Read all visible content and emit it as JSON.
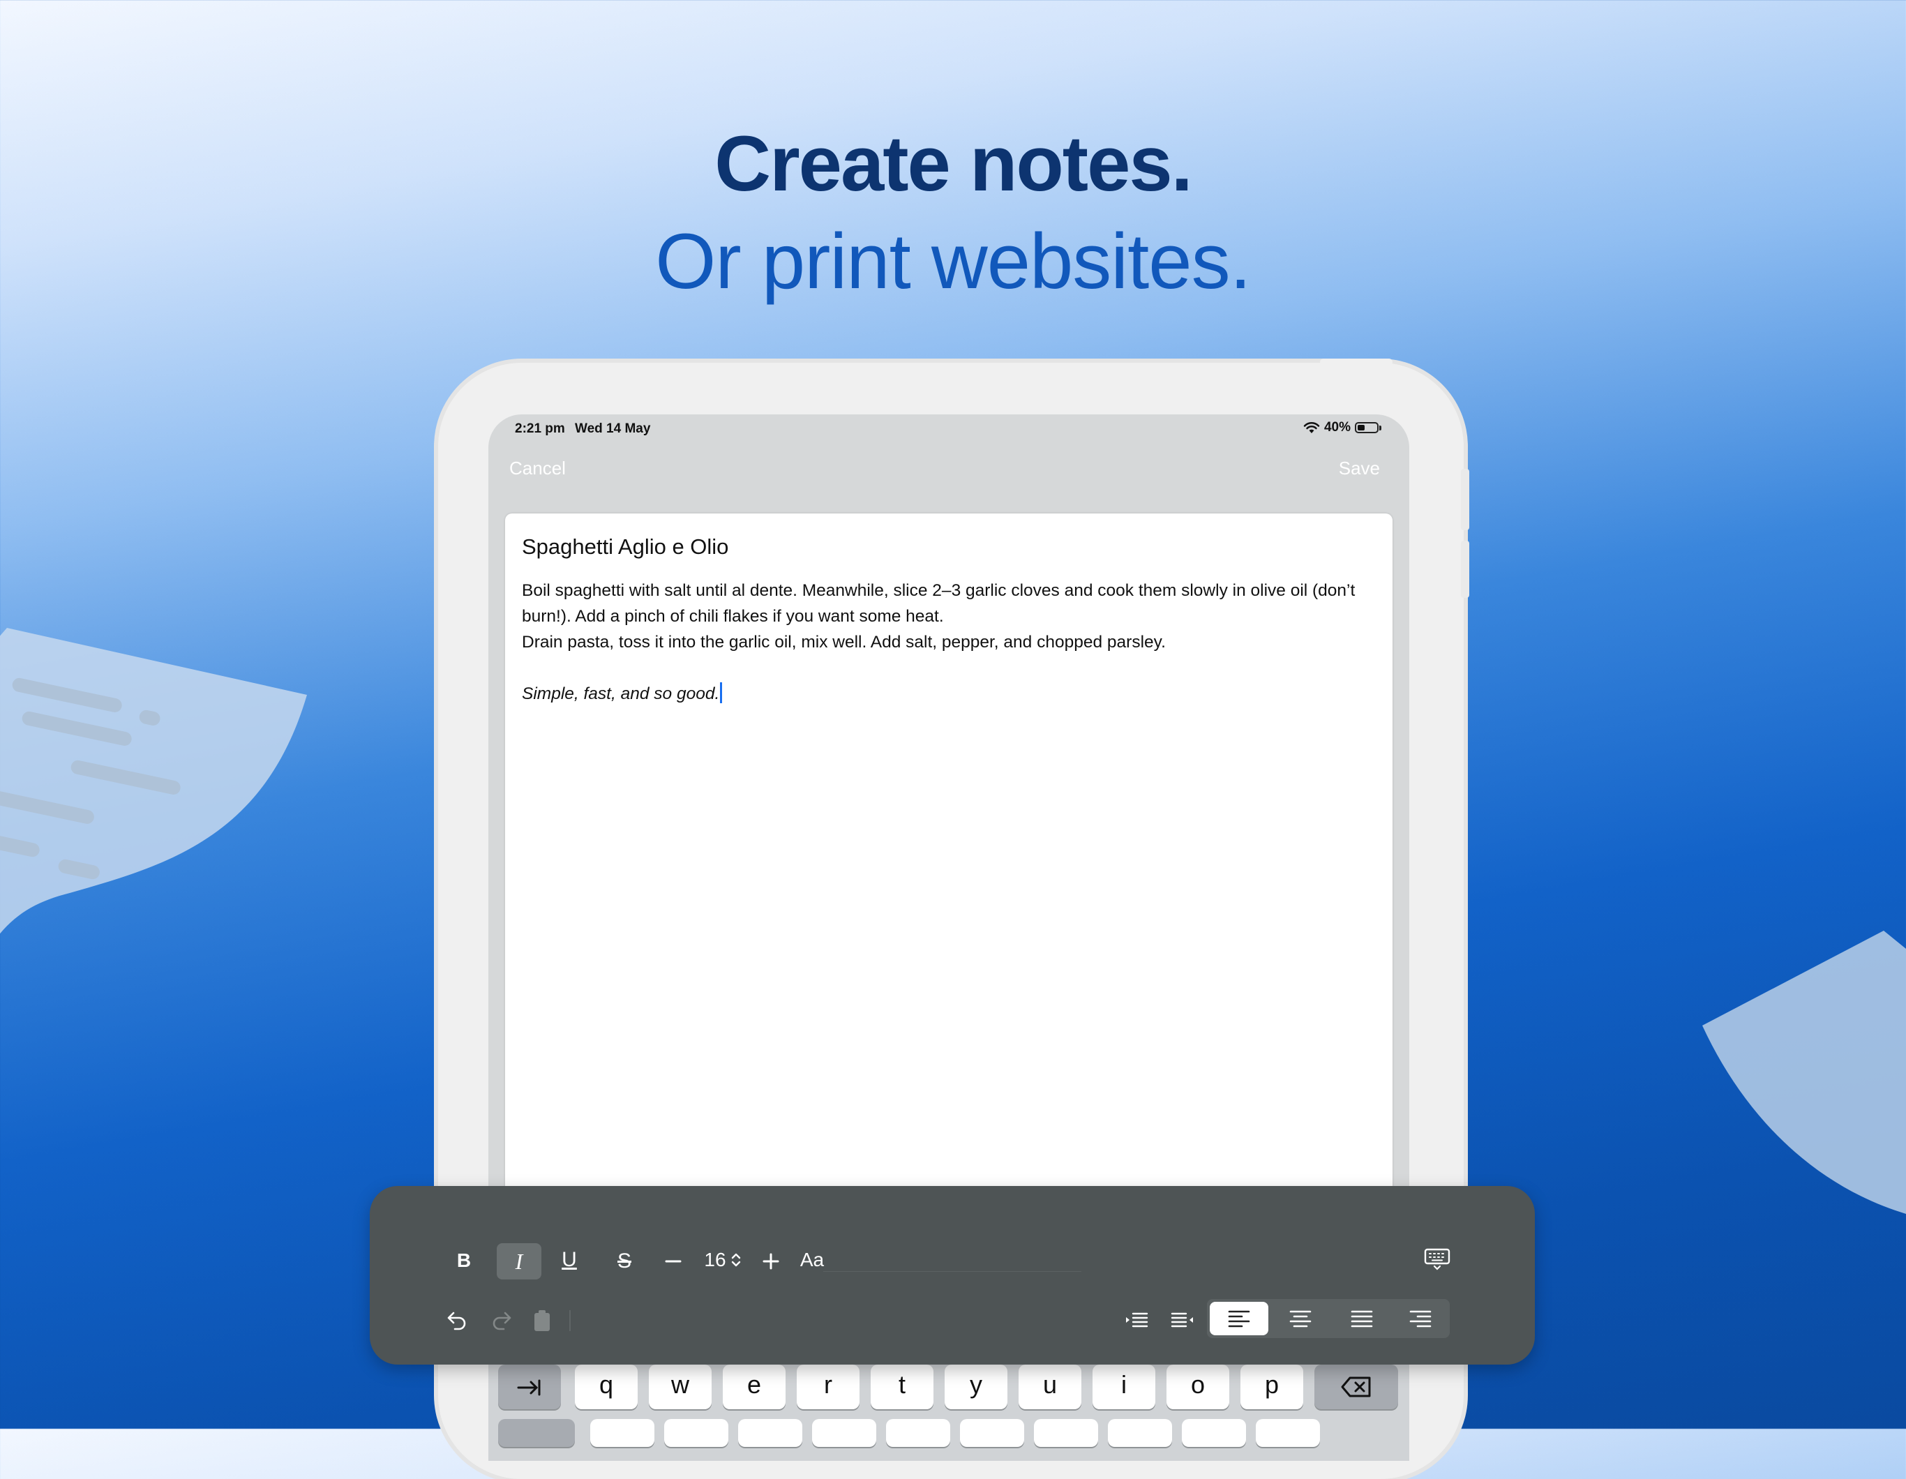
{
  "hero": {
    "title": "Create notes.",
    "subtitle": "Or print websites."
  },
  "status_bar": {
    "time": "2:21 pm",
    "date": "Wed 14 May",
    "battery": "40%",
    "battery_level": 0.4
  },
  "nav": {
    "cancel_label": "Cancel",
    "save_label": "Save"
  },
  "note": {
    "title": "Spaghetti Aglio e Olio",
    "paragraph_1": "Boil spaghetti with salt until al dente. Meanwhile, slice 2–3 garlic cloves and cook them slowly in olive oil (don’t burn!). Add a pinch of chili flakes if you want some heat.",
    "paragraph_2": "Drain pasta, toss it into the garlic oil, mix well. Add salt, pepper, and chopped parsley.",
    "closing": "Simple, fast, and so good."
  },
  "toolbar": {
    "bold_label": "B",
    "italic_label": "I",
    "underline_label": "U",
    "strikethrough_label": "S",
    "font_size": "16",
    "font_label": "Aa",
    "selected_style": "italic",
    "selected_alignment": "left",
    "icons": [
      "minus-icon",
      "stepper-icon",
      "plus-icon",
      "keyboard-icon",
      "undo-icon",
      "redo-icon",
      "paste-icon",
      "indent-increase-icon",
      "indent-decrease-icon",
      "align-left-icon",
      "align-center-icon",
      "align-justify-icon",
      "align-right-icon"
    ]
  },
  "keyboard": {
    "tab_icon": "tab-icon",
    "keys": [
      "q",
      "w",
      "e",
      "r",
      "t",
      "y",
      "u",
      "i",
      "o",
      "p"
    ],
    "delete_icon": "delete-icon"
  },
  "colors": {
    "title": "#0d3470",
    "subtitle": "#1158bb",
    "toolbar_bg": "#4e5455",
    "caret": "#1a6ff0"
  }
}
